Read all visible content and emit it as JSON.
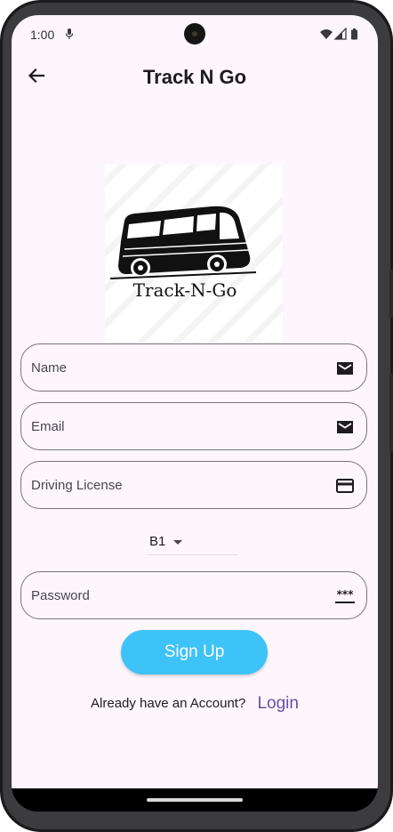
{
  "status_bar": {
    "time": "1:00",
    "icons": [
      "mic-icon",
      "wifi-icon",
      "cell-signal-icon",
      "battery-icon"
    ]
  },
  "app_bar": {
    "back_icon": "arrow-back-icon",
    "title": "Track N Go"
  },
  "logo": {
    "text": "Track-N-Go",
    "image": "bus-logo"
  },
  "form": {
    "name": {
      "placeholder": "Name",
      "icon": "mail-icon"
    },
    "email": {
      "placeholder": "Email",
      "icon": "mail-icon"
    },
    "license": {
      "placeholder": "Driving License",
      "icon": "credit-card-icon"
    },
    "license_class": {
      "value": "B1",
      "icon": "dropdown-arrow-icon"
    },
    "password": {
      "placeholder": "Password",
      "icon": "password-icon"
    },
    "signup_label": "Sign Up"
  },
  "footer": {
    "prompt": "Already have an Account?",
    "login_label": "Login"
  },
  "colors": {
    "background": "#fdf6fd",
    "button": "#3dc3f8",
    "link": "#6750a4",
    "outline": "#79747e"
  }
}
